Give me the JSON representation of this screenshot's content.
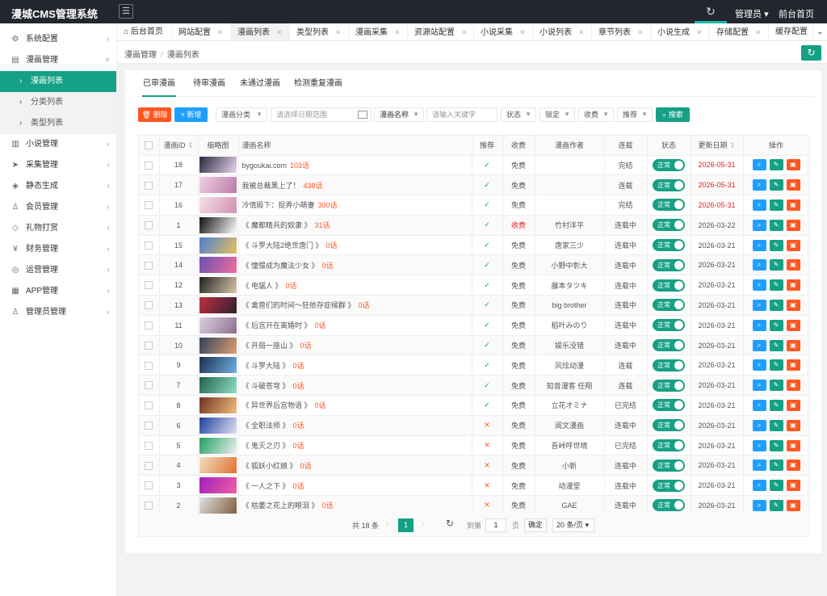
{
  "app": {
    "title": "漫城CMS管理系统",
    "admin_label": "管理员",
    "front_label": "前台首页"
  },
  "sidebar": {
    "items": [
      {
        "label": "系统配置",
        "icon": "settings-icon"
      },
      {
        "label": "漫画管理",
        "icon": "book-icon",
        "open": true
      },
      {
        "label": "小说管理",
        "icon": "novel-icon"
      },
      {
        "label": "采集管理",
        "icon": "send-icon"
      },
      {
        "label": "静态生成",
        "icon": "layers-icon"
      },
      {
        "label": "会员管理",
        "icon": "user-icon"
      },
      {
        "label": "礼物打赏",
        "icon": "diamond-icon"
      },
      {
        "label": "财务管理",
        "icon": "yen-icon"
      },
      {
        "label": "运营管理",
        "icon": "globe-icon"
      },
      {
        "label": "APP管理",
        "icon": "windows-icon"
      },
      {
        "label": "管理员管理",
        "icon": "admin-icon"
      }
    ],
    "subitems": [
      {
        "label": "漫画列表",
        "active": true
      },
      {
        "label": "分类列表"
      },
      {
        "label": "类型列表"
      }
    ]
  },
  "tabs": [
    "后台首页",
    "网站配置",
    "漫画列表",
    "类型列表",
    "漫画采集",
    "资源站配置",
    "小说采集",
    "小说列表",
    "章节列表",
    "小说生成",
    "存储配置",
    "缓存配置"
  ],
  "breadcrumb": [
    "漫画管理",
    "漫画列表"
  ],
  "subtabs": [
    "已审漫画",
    "待审漫画",
    "未通过漫画",
    "检测重复漫画"
  ],
  "toolbar": {
    "delete_label": "删除",
    "add_label": "+ 新增",
    "category_select": "漫画分类",
    "date_placeholder": "请选择日期范围",
    "field_select": "漫画名称",
    "keyword_placeholder": "请输入关键字",
    "status_select": "状态",
    "lock_select": "锁定",
    "charge_select": "收费",
    "recommend_select": "推荐",
    "search_label": "搜索"
  },
  "table": {
    "headers": [
      "漫画ID",
      "缩略图",
      "漫画名称",
      "推荐",
      "收费",
      "漫画作者",
      "连载",
      "状态",
      "更新日期",
      "操作"
    ],
    "status_label": "正常",
    "rows": [
      {
        "id": "18",
        "name": "bygoukai.com",
        "chapters": "103话",
        "rec": true,
        "fee": "免费",
        "author": "",
        "serial": "完结",
        "date": "2026-05-31",
        "date_red": true
      },
      {
        "id": "17",
        "name": "我被总裁黑上了！",
        "chapters": "438话",
        "rec": true,
        "fee": "免费",
        "author": "",
        "serial": "连载",
        "date": "2026-05-31",
        "date_red": true
      },
      {
        "id": "16",
        "name": "冷情殿下：捉弄小萌妻",
        "chapters": "300话",
        "rec": true,
        "fee": "免费",
        "author": "",
        "serial": "完结",
        "date": "2026-05-31",
        "date_red": true
      },
      {
        "id": "1",
        "name": "《 魔都精兵的奴隶 》",
        "chapters": "31话",
        "rec": true,
        "fee": "收费",
        "fee_red": true,
        "author": "竹村洋平",
        "serial": "连载中",
        "date": "2026-03-22"
      },
      {
        "id": "15",
        "name": "《 斗罗大陆2绝世唐门 》",
        "chapters": "0话",
        "rec": true,
        "fee": "免费",
        "author": "唐家三少",
        "serial": "连载中",
        "date": "2026-03-21"
      },
      {
        "id": "14",
        "name": "《 憧憬成为魔法少女 》",
        "chapters": "0话",
        "rec": true,
        "fee": "免费",
        "author": "小野中彰大",
        "serial": "连载中",
        "date": "2026-03-21"
      },
      {
        "id": "12",
        "name": "《 电锯人 》",
        "chapters": "0话",
        "rec": true,
        "fee": "免费",
        "author": "藤本タツキ",
        "serial": "连载中",
        "date": "2026-03-21"
      },
      {
        "id": "13",
        "name": "《 禽兽们的时间～狂依存症候群 》",
        "chapters": "0话",
        "rec": true,
        "fee": "免费",
        "author": "big brother",
        "serial": "连载中",
        "date": "2026-03-21"
      },
      {
        "id": "11",
        "name": "《 后宫开在离婚时 》",
        "chapters": "0话",
        "rec": true,
        "fee": "免费",
        "author": "稻叶みのり",
        "serial": "连载中",
        "date": "2026-03-21"
      },
      {
        "id": "10",
        "name": "《 开局一座山 》",
        "chapters": "0话",
        "rec": true,
        "fee": "免费",
        "author": "娱乐没错",
        "serial": "连载中",
        "date": "2026-03-21"
      },
      {
        "id": "9",
        "name": "《 斗罗大陆 》",
        "chapters": "0话",
        "rec": true,
        "fee": "免费",
        "author": "风炫动漫",
        "serial": "连载",
        "date": "2026-03-21"
      },
      {
        "id": "7",
        "name": "《 斗破苍穹 》",
        "chapters": "0话",
        "rec": true,
        "fee": "免费",
        "author": "知音漫客 任翔",
        "serial": "连载",
        "date": "2026-03-21"
      },
      {
        "id": "8",
        "name": "《 异世界后宫物语 》",
        "chapters": "0话",
        "rec": true,
        "fee": "免费",
        "author": "立花オミナ",
        "serial": "已完结",
        "date": "2026-03-21"
      },
      {
        "id": "6",
        "name": "《 全职法师 》",
        "chapters": "0话",
        "rec": false,
        "fee": "免费",
        "author": "阅文漫画",
        "serial": "连载中",
        "date": "2026-03-21"
      },
      {
        "id": "5",
        "name": "《 鬼灭之刃 》",
        "chapters": "0话",
        "rec": false,
        "fee": "免费",
        "author": "吾峠呼世晴",
        "serial": "已完结",
        "date": "2026-03-21"
      },
      {
        "id": "4",
        "name": "《 狐妖小红娘 》",
        "chapters": "0话",
        "rec": false,
        "fee": "免费",
        "author": "小新",
        "serial": "连载中",
        "date": "2026-03-21"
      },
      {
        "id": "3",
        "name": "《 一人之下 》",
        "chapters": "0话",
        "rec": false,
        "fee": "免费",
        "author": "动漫堂",
        "serial": "连载中",
        "date": "2026-03-21"
      },
      {
        "id": "2",
        "name": "《 枯萎之花上的眼泪 》",
        "chapters": "0话",
        "rec": false,
        "fee": "免费",
        "author": "GAE",
        "serial": "连载中",
        "date": "2026-03-21"
      }
    ]
  },
  "pager": {
    "total": "共 18 条",
    "current": "1",
    "goto": "到第",
    "page_input": "1",
    "page_unit": "页",
    "confirm": "确定",
    "page_size": "20 条/页"
  },
  "colors": {
    "accent": "#16a085",
    "danger": "#ff5722",
    "info": "#1e9fff",
    "topbar": "#23262e"
  }
}
